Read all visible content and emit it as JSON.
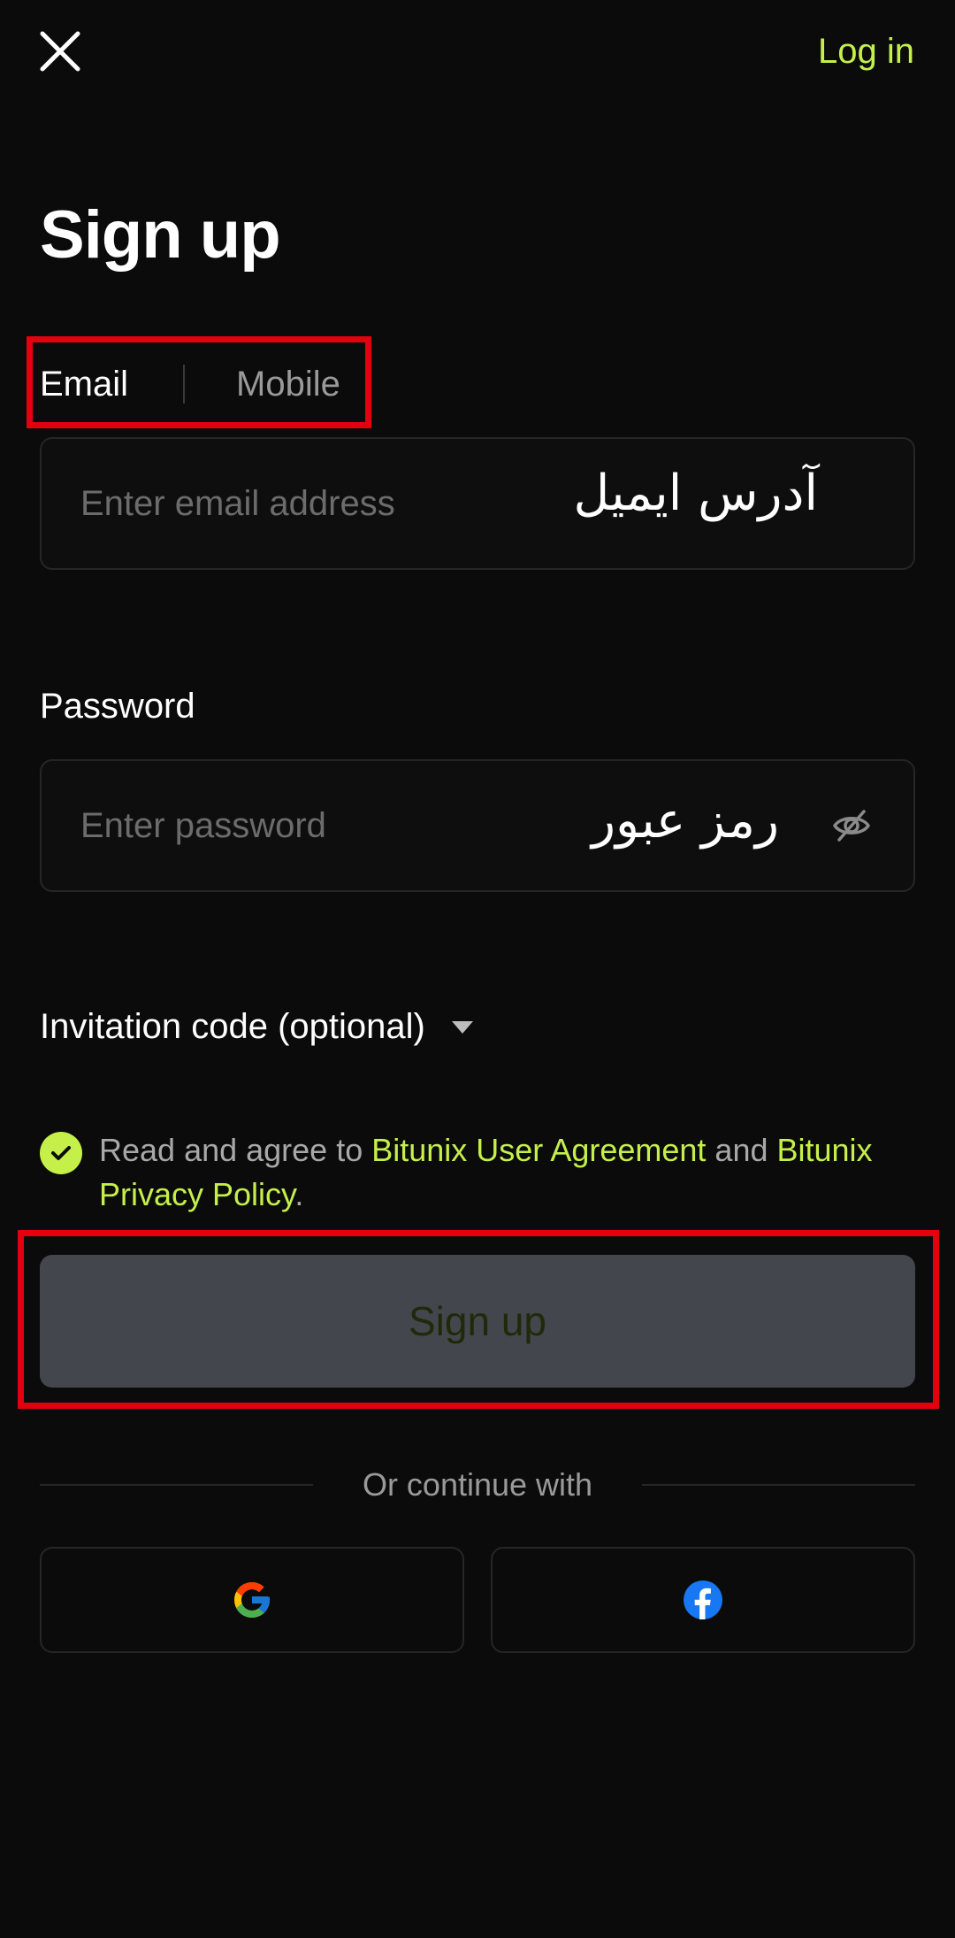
{
  "header": {
    "login_label": "Log in"
  },
  "title": "Sign up",
  "tabs": [
    {
      "label": "Email"
    },
    {
      "label": "Mobile"
    }
  ],
  "email": {
    "placeholder": "Enter email address",
    "value": "",
    "overlay_text": "آدرس ایمیل"
  },
  "password": {
    "label": "Password",
    "placeholder": "Enter password",
    "value": "",
    "overlay_text": "رمز عبور"
  },
  "invitation": {
    "label": "Invitation code (optional)"
  },
  "agreement": {
    "prefix": "Read and agree to ",
    "link1": "Bitunix User Agreement",
    "middle": " and ",
    "link2": "Bitunix Privacy Policy",
    "suffix": ".",
    "checked": true
  },
  "signup_button": "Sign up",
  "divider_text": "Or continue with",
  "social": {
    "google_icon": "google-icon",
    "facebook_icon": "facebook-icon"
  },
  "colors": {
    "accent": "#c5f04a",
    "annotation": "#e3000f",
    "background": "#0b0b0b",
    "button_disabled": "#44464d"
  }
}
